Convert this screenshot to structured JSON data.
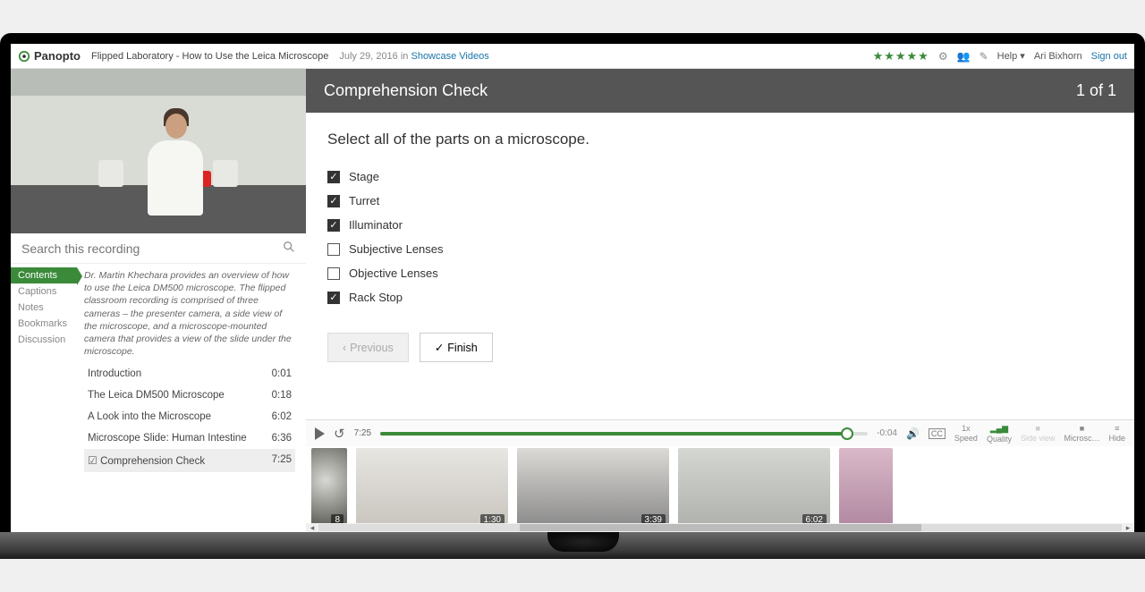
{
  "brand": "Panopto",
  "video_title": "Flipped Laboratory - How to Use the Leica Microscope",
  "date": "July 29, 2016",
  "date_in": "in",
  "date_link": "Showcase Videos",
  "rating_stars": "★★★★★",
  "help_label": "Help",
  "user_name": "Ari Bixhorn",
  "signout_label": "Sign out",
  "search_placeholder": "Search this recording",
  "tabs": [
    "Contents",
    "Captions",
    "Notes",
    "Bookmarks",
    "Discussion"
  ],
  "description": "Dr. Martin Khechara provides an overview of how to use the Leica DM500 microscope. The flipped classroom recording is comprised of three cameras – the presenter camera, a side view of the microscope, and a microscope-mounted camera that provides a view of the slide under the microscope.",
  "chapters": [
    {
      "title": "Introduction",
      "time": "0:01"
    },
    {
      "title": "The Leica DM500 Microscope",
      "time": "0:18"
    },
    {
      "title": "A Look into the Microscope",
      "time": "6:02"
    },
    {
      "title": "Microscope Slide: Human Intestine",
      "time": "6:36"
    },
    {
      "title": "Comprehension Check",
      "time": "7:25"
    }
  ],
  "quiz": {
    "header_title": "Comprehension Check",
    "header_progress": "1 of 1",
    "question": "Select all of the parts on a microscope.",
    "options": [
      {
        "label": "Stage",
        "checked": true
      },
      {
        "label": "Turret",
        "checked": true
      },
      {
        "label": "Illuminator",
        "checked": true
      },
      {
        "label": "Subjective Lenses",
        "checked": false
      },
      {
        "label": "Objective Lenses",
        "checked": false
      },
      {
        "label": "Rack Stop",
        "checked": true
      }
    ],
    "prev_label": "Previous",
    "finish_label": "Finish"
  },
  "player": {
    "current_time": "7:25",
    "remaining": "-0:04",
    "speed_value": "1x",
    "speed_label": "Speed",
    "quality_label": "Quality",
    "sideview_label": "Side view",
    "microsc_label": "Microsc…",
    "hide_label": "Hide"
  },
  "thumbs": [
    {
      "ts": "8"
    },
    {
      "ts": "1:30"
    },
    {
      "ts": "3:39"
    },
    {
      "ts": "6:02"
    },
    {
      "ts": ""
    }
  ]
}
